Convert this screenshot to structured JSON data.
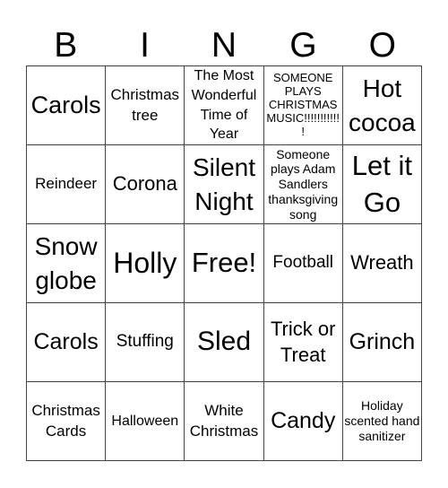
{
  "header": {
    "letters": [
      "B",
      "I",
      "N",
      "G",
      "O"
    ]
  },
  "board": {
    "rows": [
      [
        "Carols",
        "Christmas tree",
        "The Most Wonderful Time of Year",
        "SOMEONE PLAYS CHRISTMAS MUSIC!!!!!!!!!!!!",
        "Hot cocoa"
      ],
      [
        "Reindeer",
        "Corona",
        "Silent Night",
        "Someone plays Adam Sandlers thanksgiving song",
        "Let it Go"
      ],
      [
        "Snow globe",
        "Holly",
        "Free!",
        "Football",
        "Wreath"
      ],
      [
        "Carols",
        "Stuffing",
        "Sled",
        "Trick or Treat",
        "Grinch"
      ],
      [
        "Christmas Cards",
        "Halloween",
        "White Christmas",
        "Candy",
        "Holiday scented hand sanitizer"
      ]
    ]
  }
}
